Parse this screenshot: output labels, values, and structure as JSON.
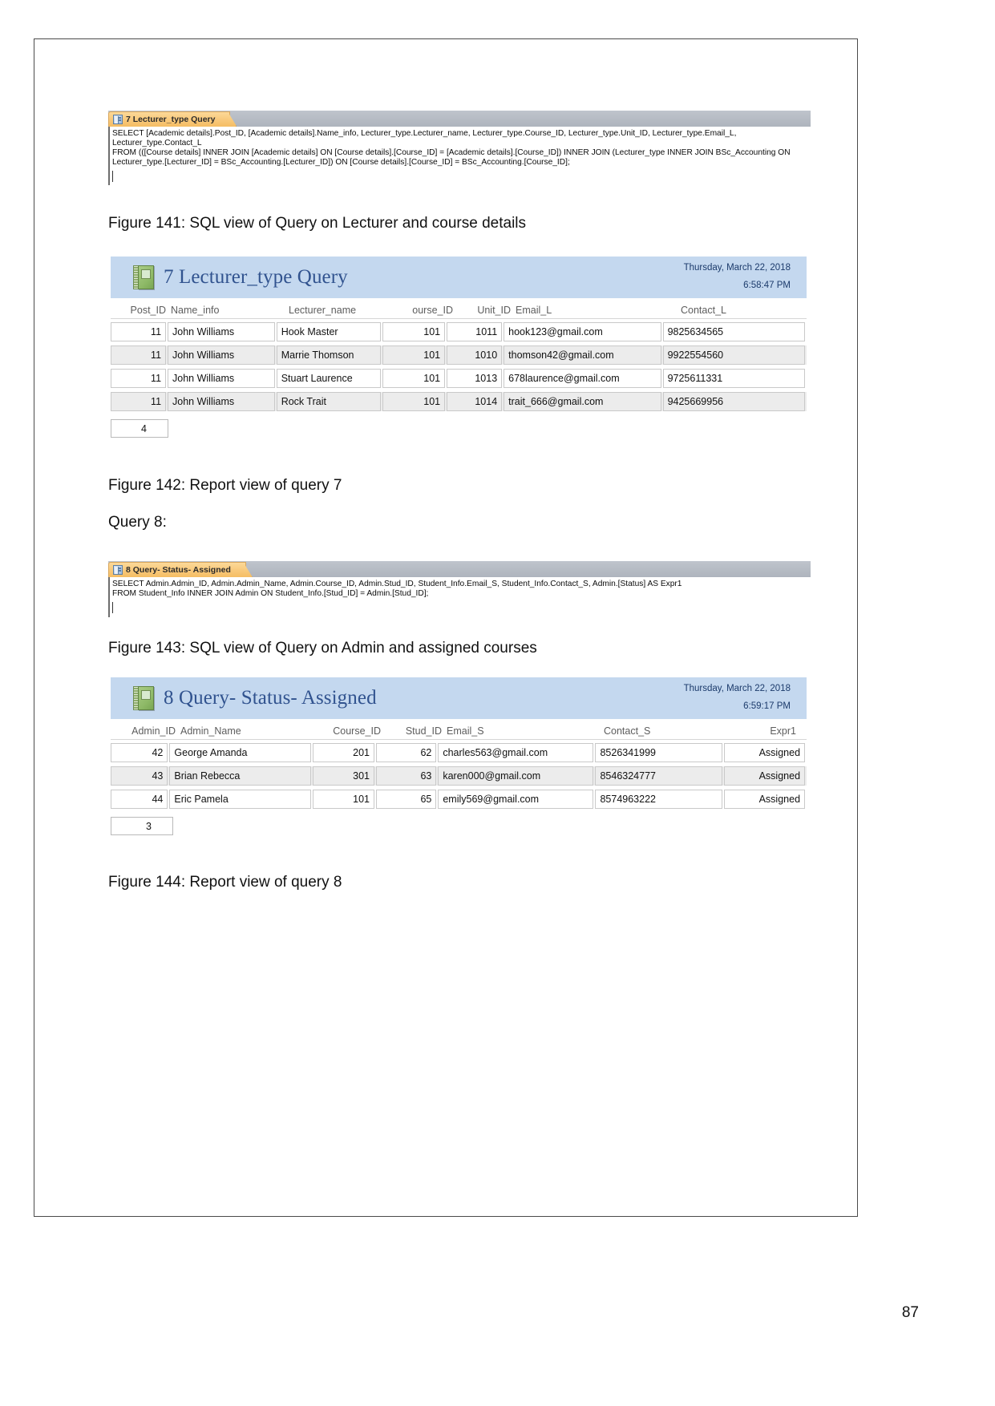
{
  "document": {
    "page_number": "87"
  },
  "sql_view_1": {
    "tab_label": "7 Lecturer_type Query",
    "tab_icon": "query-icon",
    "sql": "SELECT [Academic details].Post_ID, [Academic details].Name_info, Lecturer_type.Lecturer_name, Lecturer_type.Course_ID, Lecturer_type.Unit_ID, Lecturer_type.Email_L, Lecturer_type.Contact_L\nFROM (([Course details] INNER JOIN [Academic details] ON [Course details].[Course_ID] = [Academic details].[Course_ID]) INNER JOIN (Lecturer_type INNER JOIN BSc_Accounting ON Lecturer_type.[Lecturer_ID] = BSc_Accounting.[Lecturer_ID]) ON [Course details].[Course_ID] = BSc_Accounting.[Course_ID];"
  },
  "caption_141": "Figure 141: SQL view of Query on Lecturer and course details",
  "report_1": {
    "icon": "report-notepad-icon",
    "title": "7 Lecturer_type Query",
    "date": "Thursday, March 22, 2018",
    "time": "6:58:47 PM",
    "columns": [
      "Post_ID",
      "Name_info",
      "Lecturer_name",
      "ourse_ID",
      "Unit_ID",
      "Email_L",
      "Contact_L"
    ],
    "rows": [
      [
        "11",
        "John Williams",
        "Hook Master",
        "101",
        "1011",
        "hook123@gmail.com",
        "9825634565"
      ],
      [
        "11",
        "John Williams",
        "Marrie Thomson",
        "101",
        "1010",
        "thomson42@gmail.com",
        "9922554560"
      ],
      [
        "11",
        "John Williams",
        "Stuart Laurence",
        "101",
        "1013",
        "678laurence@gmail.com",
        "9725611331"
      ],
      [
        "11",
        "John Williams",
        "Rock Trait",
        "101",
        "1014",
        "trait_666@gmail.com",
        "9425669956"
      ]
    ],
    "record_count": "4"
  },
  "caption_142": "Figure 142: Report view of query 7",
  "query8_heading": "Query 8:",
  "sql_view_2": {
    "tab_label": "8 Query- Status- Assigned",
    "tab_icon": "query-icon",
    "sql": "SELECT Admin.Admin_ID, Admin.Admin_Name, Admin.Course_ID, Admin.Stud_ID, Student_Info.Email_S, Student_Info.Contact_S, Admin.[Status] AS Expr1\nFROM Student_Info INNER JOIN Admin ON Student_Info.[Stud_ID] = Admin.[Stud_ID];"
  },
  "caption_143": "Figure 143: SQL view of Query on Admin and assigned courses",
  "report_2": {
    "icon": "report-notepad-icon",
    "title": "8 Query- Status- Assigned",
    "date": "Thursday, March 22, 2018",
    "time": "6:59:17 PM",
    "columns": [
      "Admin_ID",
      "Admin_Name",
      "Course_ID",
      "Stud_ID",
      "Email_S",
      "Contact_S",
      "Expr1"
    ],
    "rows": [
      [
        "42",
        "George Amanda",
        "201",
        "62",
        "charles563@gmail.com",
        "8526341999",
        "Assigned"
      ],
      [
        "43",
        "Brian Rebecca",
        "301",
        "63",
        "karen000@gmail.com",
        "8546324777",
        "Assigned"
      ],
      [
        "44",
        "Eric Pamela",
        "101",
        "65",
        "emily569@gmail.com",
        "8574963222",
        "Assigned"
      ]
    ],
    "record_count": "3"
  },
  "caption_144": "Figure 144: Report view of query 8",
  "colors": {
    "report_header_bg": "#c4d8ef",
    "report_title": "#31538f",
    "tab_orange": "#f5bd63",
    "toolbar_gray": "#b6bbc4"
  }
}
